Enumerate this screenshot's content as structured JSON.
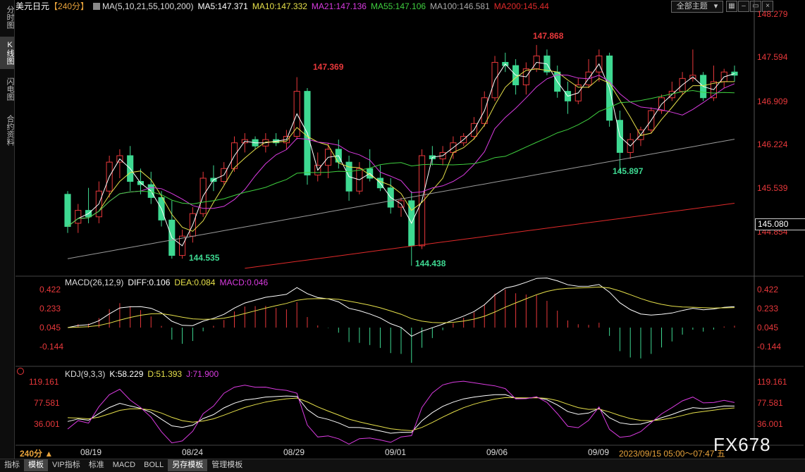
{
  "sidebar": {
    "tabs": [
      "分时图",
      "K线图",
      "闪电图",
      "合约资料"
    ],
    "active": 1
  },
  "title": {
    "symbol": "美元日元",
    "period": "【240分】",
    "ma_params": "MA(5,10,21,55,100,200)",
    "ma5": "MA5:147.371",
    "ma10": "MA10:147.332",
    "ma21": "MA21:147.136",
    "ma55": "MA55:147.106",
    "ma100": "MA100:146.581",
    "ma200": "MA200:145.44",
    "theme_button": "全部主题",
    "colors": {
      "ma5": "#ffffff",
      "ma10": "#e6e04a",
      "ma21": "#d93be0",
      "ma55": "#3fcf3f",
      "ma100": "#9a9a9a",
      "ma200": "#e02a2a",
      "up": "#e8383b",
      "down": "#3ed992"
    }
  },
  "price_axis": {
    "ticks": [
      "148.279",
      "147.594",
      "146.909",
      "146.224",
      "145.539",
      "144.854"
    ],
    "current_price": "145.080"
  },
  "annotations": {
    "high1": "147.369",
    "high2": "147.868",
    "low1": "144.535",
    "low2": "144.438",
    "low3": "145.897"
  },
  "macd": {
    "label": "MACD(26,12,9)",
    "diff": "DIFF:0.106",
    "dea": "DEA:0.084",
    "macd": "MACD:0.046",
    "ticks": [
      "0.422",
      "0.233",
      "0.045",
      "-0.144"
    ]
  },
  "kdj": {
    "label": "KDJ(9,3,3)",
    "k": "K:58.229",
    "d": "D:51.393",
    "j": "J:71.900",
    "ticks": [
      "119.161",
      "77.581",
      "36.001"
    ]
  },
  "x_axis": {
    "period_button": "240分 ▲",
    "dates": [
      "08/19",
      "08/24",
      "08/29",
      "09/01",
      "09/06",
      "09/09"
    ],
    "time_range": "2023/09/15 05:00～07:47 五"
  },
  "watermark": "FX678",
  "bottom_tabs": [
    "指标",
    "模板",
    "VIP指标",
    "标准",
    "MACD",
    "BOLL",
    "另存模板",
    "管理模板"
  ],
  "bottom_active": [
    1,
    6
  ],
  "chart_data": {
    "type": "candlestick",
    "title": "美元日元【240分】",
    "ylim": [
      144.3,
      148.35
    ],
    "x_labels": [
      "08/19",
      "08/24",
      "08/29",
      "09/01",
      "09/06",
      "09/09"
    ],
    "ohlc": [
      [
        145.55,
        145.6,
        144.95,
        145.05
      ],
      [
        145.1,
        145.4,
        144.95,
        145.3
      ],
      [
        145.3,
        145.65,
        145.1,
        145.2
      ],
      [
        145.2,
        145.75,
        145.1,
        145.6
      ],
      [
        145.6,
        146.15,
        145.5,
        146.05
      ],
      [
        146.05,
        146.25,
        145.8,
        146.15
      ],
      [
        146.15,
        146.3,
        145.6,
        145.75
      ],
      [
        145.75,
        145.95,
        145.55,
        145.7
      ],
      [
        145.7,
        145.9,
        145.4,
        145.5
      ],
      [
        145.5,
        145.6,
        145.05,
        145.15
      ],
      [
        145.15,
        145.45,
        144.55,
        144.6
      ],
      [
        144.6,
        145.0,
        144.55,
        144.9
      ],
      [
        144.9,
        145.35,
        144.8,
        145.25
      ],
      [
        145.25,
        145.9,
        145.2,
        145.8
      ],
      [
        145.8,
        146.0,
        145.6,
        145.75
      ],
      [
        145.75,
        146.05,
        145.7,
        145.95
      ],
      [
        145.95,
        146.45,
        145.9,
        146.35
      ],
      [
        146.35,
        146.5,
        146.2,
        146.4
      ],
      [
        146.4,
        146.45,
        146.25,
        146.3
      ],
      [
        146.3,
        146.5,
        146.2,
        146.4
      ],
      [
        146.4,
        146.5,
        146.3,
        146.35
      ],
      [
        146.35,
        146.55,
        146.25,
        146.45
      ],
      [
        146.45,
        147.37,
        146.4,
        147.15
      ],
      [
        147.15,
        147.2,
        145.7,
        145.85
      ],
      [
        145.85,
        146.2,
        145.75,
        146.0
      ],
      [
        146.0,
        146.35,
        145.8,
        146.25
      ],
      [
        146.25,
        146.4,
        145.95,
        146.05
      ],
      [
        146.05,
        146.15,
        145.45,
        145.6
      ],
      [
        145.6,
        146.05,
        145.55,
        145.95
      ],
      [
        145.95,
        146.25,
        145.75,
        145.8
      ],
      [
        145.8,
        146.0,
        145.6,
        145.65
      ],
      [
        145.65,
        145.8,
        145.25,
        145.35
      ],
      [
        145.35,
        145.5,
        145.2,
        145.45
      ],
      [
        145.45,
        145.6,
        144.44,
        144.75
      ],
      [
        144.75,
        146.25,
        144.7,
        146.15
      ],
      [
        146.15,
        146.3,
        146.0,
        146.1
      ],
      [
        146.1,
        146.3,
        146.0,
        146.2
      ],
      [
        146.2,
        146.45,
        146.1,
        146.35
      ],
      [
        146.35,
        146.5,
        146.3,
        146.45
      ],
      [
        146.45,
        146.75,
        146.4,
        146.65
      ],
      [
        146.65,
        147.15,
        146.6,
        147.05
      ],
      [
        147.05,
        147.7,
        147.0,
        147.6
      ],
      [
        147.6,
        147.75,
        147.45,
        147.55
      ],
      [
        147.55,
        147.65,
        147.1,
        147.25
      ],
      [
        147.25,
        147.6,
        147.1,
        147.5
      ],
      [
        147.5,
        147.87,
        147.45,
        147.7
      ],
      [
        147.7,
        147.8,
        147.4,
        147.45
      ],
      [
        147.45,
        147.55,
        147.05,
        147.15
      ],
      [
        147.15,
        147.3,
        146.8,
        147.0
      ],
      [
        147.0,
        147.35,
        146.95,
        147.25
      ],
      [
        147.25,
        147.65,
        147.2,
        147.45
      ],
      [
        147.45,
        147.8,
        147.3,
        147.7
      ],
      [
        147.7,
        147.75,
        146.6,
        146.7
      ],
      [
        146.7,
        146.85,
        145.9,
        146.2
      ],
      [
        146.2,
        146.5,
        146.1,
        146.4
      ],
      [
        146.4,
        146.6,
        146.3,
        146.55
      ],
      [
        146.55,
        146.9,
        146.5,
        146.85
      ],
      [
        146.85,
        147.1,
        146.8,
        147.05
      ],
      [
        147.05,
        147.3,
        147.0,
        147.15
      ],
      [
        147.15,
        147.45,
        147.1,
        147.35
      ],
      [
        147.35,
        147.8,
        147.3,
        147.4
      ],
      [
        147.4,
        147.45,
        147.0,
        147.05
      ],
      [
        147.05,
        147.55,
        147.0,
        147.3
      ],
      [
        147.3,
        147.5,
        147.2,
        147.45
      ],
      [
        147.45,
        147.55,
        147.3,
        147.4
      ]
    ]
  }
}
